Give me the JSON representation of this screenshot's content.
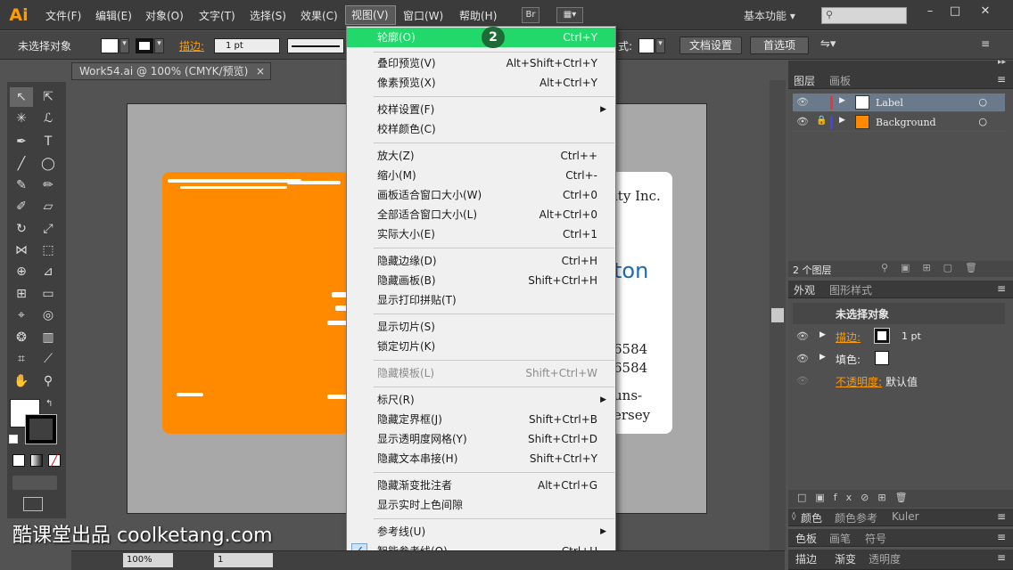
{
  "app": {
    "logo": "Ai",
    "workspace": "基本功能",
    "bridge": "Br"
  },
  "menubar": [
    "文件(F)",
    "编辑(E)",
    "对象(O)",
    "文字(T)",
    "选择(S)",
    "效果(C)",
    "视图(V)",
    "窗口(W)",
    "帮助(H)"
  ],
  "control": {
    "selection": "未选择对象",
    "stroke_label": "描边:",
    "stroke_value": "1 pt",
    "style_label": "式:",
    "doc_setup": "文档设置",
    "preferences": "首选项"
  },
  "document_tab": {
    "title": "Work54.ai @ 100% (CMYK/预览)",
    "close": "×"
  },
  "view_menu": {
    "items": [
      {
        "label": "轮廓(O)",
        "shortcut": "Ctrl+Y",
        "highlight": true
      },
      {
        "label": "叠印预览(V)",
        "shortcut": "Alt+Shift+Ctrl+Y"
      },
      {
        "label": "像素预览(X)",
        "shortcut": "Alt+Ctrl+Y"
      },
      {
        "label": "校样设置(F)",
        "shortcut": "",
        "submenu": true
      },
      {
        "label": "校样颜色(C)",
        "shortcut": ""
      },
      {
        "label": "放大(Z)",
        "shortcut": "Ctrl++"
      },
      {
        "label": "缩小(M)",
        "shortcut": "Ctrl+-"
      },
      {
        "label": "画板适合窗口大小(W)",
        "shortcut": "Ctrl+0"
      },
      {
        "label": "全部适合窗口大小(L)",
        "shortcut": "Alt+Ctrl+0"
      },
      {
        "label": "实际大小(E)",
        "shortcut": "Ctrl+1"
      },
      {
        "label": "隐藏边缘(D)",
        "shortcut": "Ctrl+H"
      },
      {
        "label": "隐藏画板(B)",
        "shortcut": "Shift+Ctrl+H"
      },
      {
        "label": "显示打印拼贴(T)",
        "shortcut": ""
      },
      {
        "label": "显示切片(S)",
        "shortcut": ""
      },
      {
        "label": "锁定切片(K)",
        "shortcut": ""
      },
      {
        "label": "隐藏模板(L)",
        "shortcut": "Shift+Ctrl+W",
        "disabled": true
      },
      {
        "label": "标尺(R)",
        "shortcut": "",
        "submenu": true
      },
      {
        "label": "隐藏定界框(J)",
        "shortcut": "Shift+Ctrl+B"
      },
      {
        "label": "显示透明度网格(Y)",
        "shortcut": "Shift+Ctrl+D"
      },
      {
        "label": "隐藏文本串接(H)",
        "shortcut": "Shift+Ctrl+Y"
      },
      {
        "label": "隐藏渐变批注者",
        "shortcut": "Alt+Ctrl+G"
      },
      {
        "label": "显示实时上色间隙",
        "shortcut": ""
      },
      {
        "label": "参考线(U)",
        "shortcut": "",
        "submenu": true
      },
      {
        "label": "智能参考线(Q)",
        "shortcut": "Ctrl+U",
        "checked": true
      }
    ],
    "step_badge": "2",
    "submenu_arrow": "▶",
    "check": "✓"
  },
  "card": {
    "company": "ity Inc.",
    "name_fragment": "ton",
    "phone1": "6584",
    "phone2": "6584",
    "addr1": "uns-",
    "addr2": "ersey"
  },
  "layers_panel": {
    "tabs": [
      "图层",
      "画板"
    ],
    "layers": [
      {
        "name": "Label"
      },
      {
        "name": "Background"
      }
    ],
    "count": "2 个图层"
  },
  "appearance_panel": {
    "tabs": [
      "外观",
      "图形样式"
    ],
    "title": "未选择对象",
    "rows": [
      {
        "label": "描边:",
        "value": "1 pt"
      },
      {
        "label": "填色:",
        "value": ""
      },
      {
        "label": "不透明度:",
        "value": "默认值"
      }
    ]
  },
  "bottom_tabs": [
    [
      "颜色",
      "颜色参考",
      "Kuler"
    ],
    [
      "色板",
      "画笔",
      "符号"
    ],
    [
      "描边",
      "渐变",
      "透明度"
    ]
  ],
  "statusbar": {
    "zoom": "100%",
    "page": "1"
  },
  "watermark": "酷课堂出品 coolketang.com",
  "colors": {
    "accent": "#ff8a00",
    "highlight": "#23d86b"
  }
}
